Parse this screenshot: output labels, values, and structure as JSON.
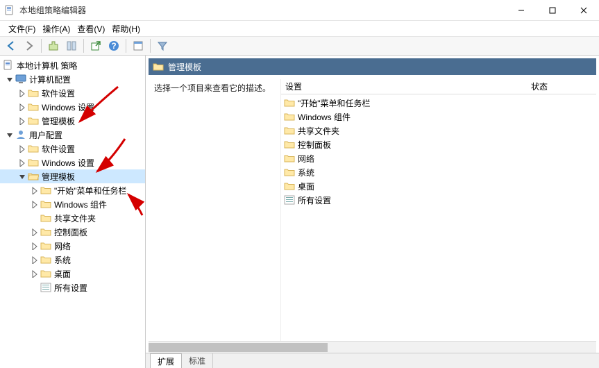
{
  "window": {
    "title": "本地组策略编辑器",
    "min_tooltip": "最小化",
    "max_tooltip": "最大化",
    "close_tooltip": "关闭"
  },
  "menu": {
    "file": "文件(F)",
    "action": "操作(A)",
    "view": "查看(V)",
    "help": "帮助(H)"
  },
  "toolbar": {
    "back": "back",
    "forward": "forward",
    "up": "up",
    "show_hide": "show-hide",
    "properties": "properties",
    "export": "export",
    "help": "help",
    "icons_view": "icons-view",
    "filter": "filter"
  },
  "tree": {
    "root": "本地计算机 策略",
    "computer": {
      "label": "计算机配置",
      "software": "软件设置",
      "windows": "Windows 设置",
      "admin": "管理模板"
    },
    "user": {
      "label": "用户配置",
      "software": "软件设置",
      "windows": "Windows 设置",
      "admin": {
        "label": "管理模板",
        "start_taskbar": "\"开始\"菜单和任务栏",
        "windows_components": "Windows 组件",
        "shared_folders": "共享文件夹",
        "control_panel": "控制面板",
        "network": "网络",
        "system": "系统",
        "desktop": "桌面",
        "all_settings": "所有设置"
      }
    }
  },
  "content": {
    "header": "管理模板",
    "hint": "选择一个项目来查看它的描述。",
    "col_setting": "设置",
    "col_state": "状态",
    "items": {
      "start_taskbar": "\"开始\"菜单和任务栏",
      "windows_components": "Windows 组件",
      "shared_folders": "共享文件夹",
      "control_panel": "控制面板",
      "network": "网络",
      "system": "系统",
      "desktop": "桌面",
      "all_settings": "所有设置"
    }
  },
  "tabs": {
    "extended": "扩展",
    "standard": "标准"
  }
}
